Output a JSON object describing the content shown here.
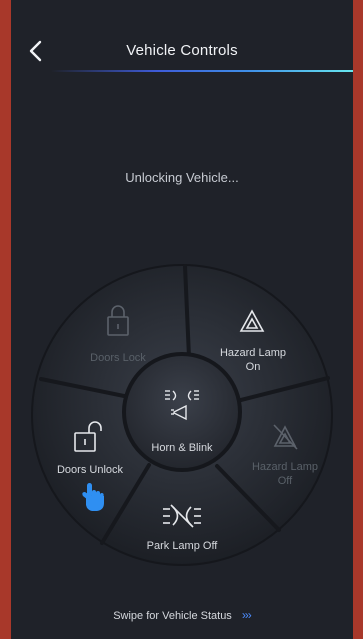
{
  "header": {
    "back_icon": "chevron-left-icon",
    "title": "Vehicle Controls"
  },
  "status": {
    "text": "Unlocking Vehicle..."
  },
  "wheel": {
    "doors_lock": {
      "label": "Doors Lock",
      "icon": "lock-closed-icon",
      "enabled": false
    },
    "hazard_on": {
      "label_line1": "Hazard Lamp",
      "label_line2": "On",
      "icon": "hazard-triangle-icon",
      "enabled": true
    },
    "hazard_off": {
      "label_line1": "Hazard Lamp",
      "label_line2": "Off",
      "icon": "hazard-off-icon",
      "enabled": false
    },
    "park_lamp_off": {
      "label": "Park Lamp Off",
      "icon": "park-lamp-off-icon",
      "enabled": true
    },
    "doors_unlock": {
      "label": "Doors Unlock",
      "icon": "lock-open-icon",
      "enabled": true,
      "pointer_icon": "hand-pointer-icon",
      "pointer_color": "#2f8ff2"
    },
    "horn_blink": {
      "label": "Horn & Blink",
      "icon": "horn-blink-icon",
      "enabled": true
    }
  },
  "footer": {
    "text": "Swipe for Vehicle Status",
    "arrows": "›››"
  },
  "colors": {
    "frame": "#a8382a",
    "background": "#1f2229",
    "accent_gradient_start": "#3e5bd8",
    "accent_gradient_end": "#67e7ef",
    "pointer": "#2f8ff2"
  }
}
